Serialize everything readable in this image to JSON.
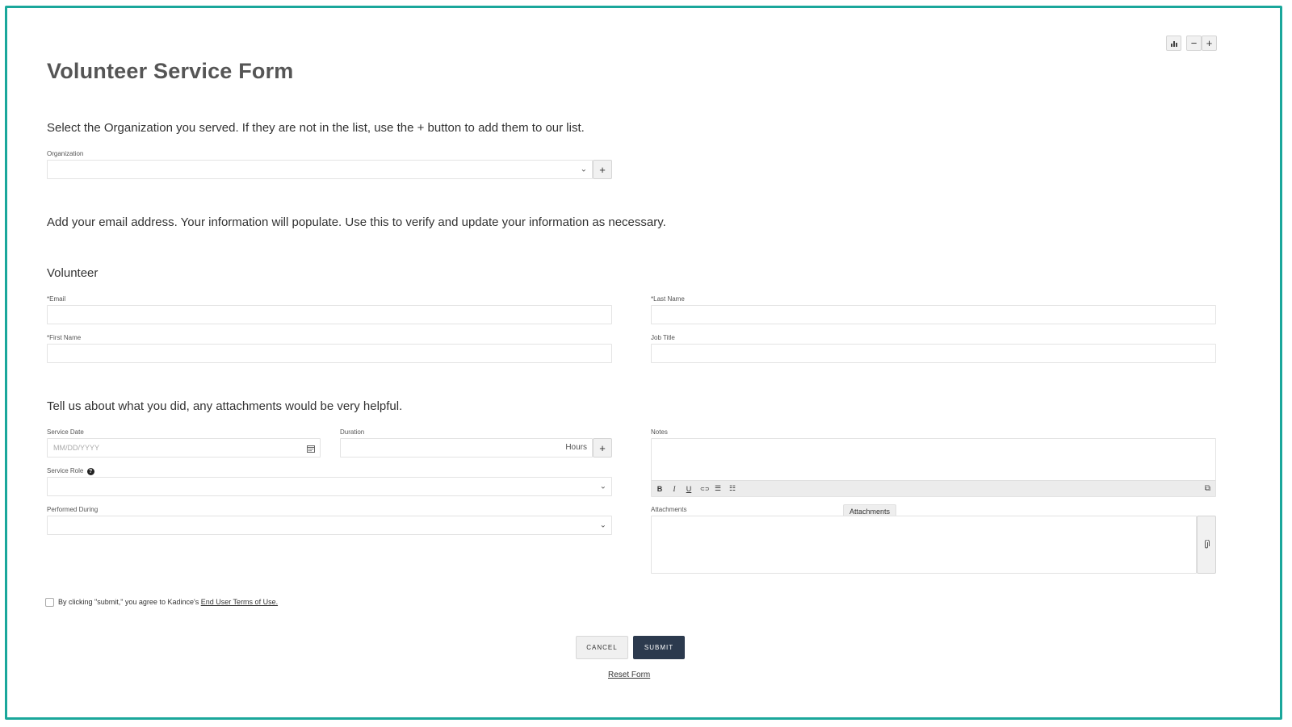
{
  "top_toolbar": {
    "chart_icon": "bar-chart-icon",
    "minus_label": "−",
    "plus_label": "+"
  },
  "page": {
    "title": "Volunteer Service Form"
  },
  "organization_section": {
    "instruction": "Select the Organization you served. If they are not in the list, use the + button to add them to our list.",
    "label": "Organization",
    "value": "",
    "add_label": "+"
  },
  "email_section": {
    "instruction": "Add your email address. Your information will populate. Use this to verify and update your information as necessary."
  },
  "volunteer": {
    "heading": "Volunteer",
    "email_label": "*Email",
    "last_name_label": "*Last Name",
    "first_name_label": "*First Name",
    "job_title_label": "Job Title"
  },
  "service_section": {
    "instruction": "Tell us about what you did, any attachments would be very helpful.",
    "service_date_label": "Service Date",
    "service_date_placeholder": "MM/DD/YYYY",
    "duration_label": "Duration",
    "duration_unit": "Hours",
    "duration_add_label": "+",
    "service_role_label": "Service Role",
    "performed_during_label": "Performed During",
    "notes_label": "Notes",
    "attachments_label": "Attachments",
    "attachments_tooltip": "Attachments",
    "toolbar": {
      "bold": "B",
      "italic": "I",
      "underline": "U",
      "link": "⊂⊃",
      "bullets": "☰",
      "numbers": "☷",
      "expand": "⧉"
    }
  },
  "terms": {
    "prefix": "By clicking \"submit,\" you agree to Kadince's ",
    "link_text": "End User Terms of Use."
  },
  "actions": {
    "cancel_label": "CANCEL",
    "submit_label": "SUBMIT",
    "reset_label": "Reset Form"
  },
  "colors": {
    "frame": "#1aa79b",
    "submit_bg": "#2c3a4e"
  }
}
